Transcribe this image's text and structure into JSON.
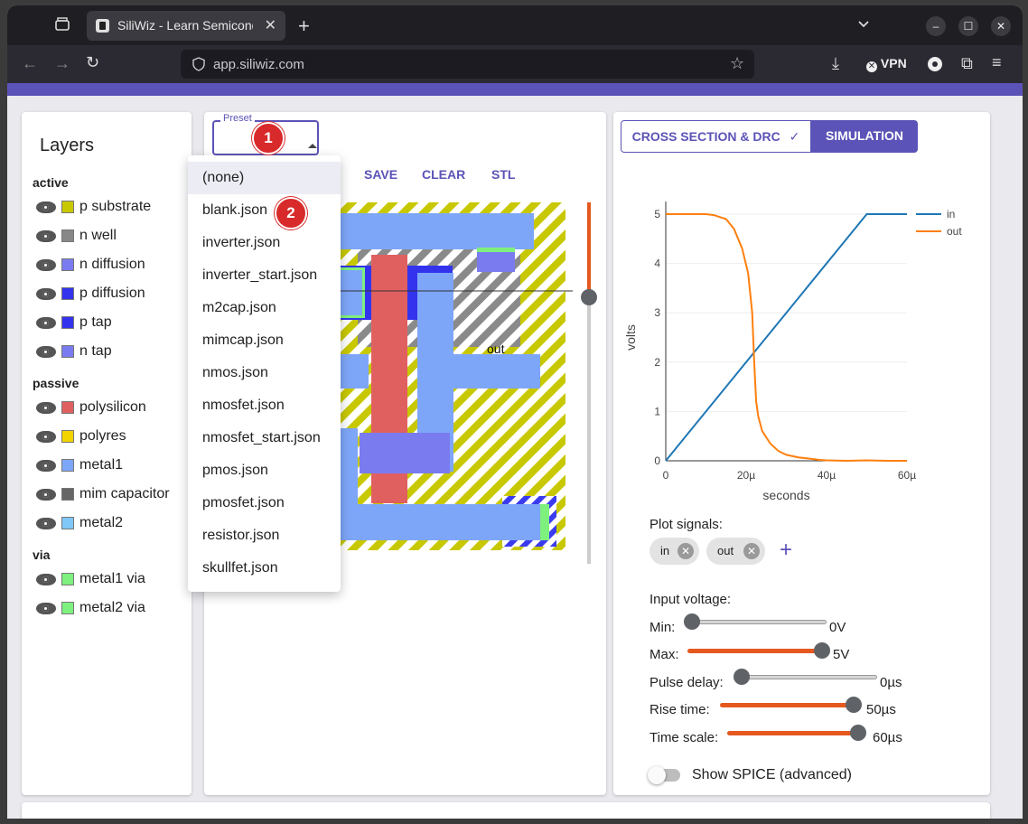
{
  "browser": {
    "tab_title": "SiliWiz - Learn Semiconductor",
    "url": "app.siliwiz.com",
    "vpn_label": "VPN"
  },
  "layers": {
    "title": "Layers",
    "groups": [
      {
        "label": "active",
        "items": [
          {
            "label": "p substrate",
            "color": "#c8c800"
          },
          {
            "label": "n well",
            "color": "#888888"
          },
          {
            "label": "n diffusion",
            "color": "#7b7bf0"
          },
          {
            "label": "p diffusion",
            "color": "#3333ee"
          },
          {
            "label": "p tap",
            "color": "#3333ee"
          },
          {
            "label": "n tap",
            "color": "#7b7bf0"
          }
        ]
      },
      {
        "label": "passive",
        "items": [
          {
            "label": "polysilicon",
            "color": "#e06060"
          },
          {
            "label": "polyres",
            "color": "#f2d400"
          },
          {
            "label": "metal1",
            "color": "#7ea6f8"
          },
          {
            "label": "mim capacitor",
            "color": "#666666"
          },
          {
            "label": "metal2",
            "color": "#7fc8f8"
          }
        ]
      },
      {
        "label": "via",
        "items": [
          {
            "label": "metal1 via",
            "color": "#7ef07e"
          },
          {
            "label": "metal2 via",
            "color": "#7ef07e"
          }
        ]
      }
    ]
  },
  "editor": {
    "preset_label": "Preset",
    "buttons": [
      "SAVE",
      "CLEAR",
      "STL"
    ],
    "canvas_label": "out",
    "preset_options": [
      "(none)",
      "blank.json",
      "inverter.json",
      "inverter_start.json",
      "m2cap.json",
      "mimcap.json",
      "nmos.json",
      "nmosfet.json",
      "nmosfet_start.json",
      "pmos.json",
      "pmosfet.json",
      "resistor.json",
      "skullfet.json"
    ]
  },
  "badges": [
    "1",
    "2"
  ],
  "simulation": {
    "tab_cross_section": "CROSS SECTION & DRC",
    "tab_simulation": "SIMULATION",
    "plot_signals_label": "Plot signals:",
    "signals": [
      "in",
      "out"
    ],
    "input_voltage_label": "Input voltage:",
    "sliders": [
      {
        "label": "Min:",
        "value": "0V",
        "fraction": 0.0
      },
      {
        "label": "Max:",
        "value": "5V",
        "fraction": 1.0
      },
      {
        "label": "Pulse delay:",
        "value": "0µs",
        "fraction": 0.0
      },
      {
        "label": "Rise time:",
        "value": "50µs",
        "fraction": 1.0
      },
      {
        "label": "Time scale:",
        "value": "60µs",
        "fraction": 1.0
      }
    ],
    "show_spice_label": "Show SPICE (advanced)"
  },
  "chart_data": {
    "type": "line",
    "xlabel": "seconds",
    "ylabel": "volts",
    "xlim": [
      0,
      60
    ],
    "ylim": [
      0,
      5
    ],
    "xticks": [
      "0",
      "20µ",
      "40µ",
      "60µ"
    ],
    "yticks": [
      "0",
      "1",
      "2",
      "3",
      "4",
      "5"
    ],
    "legend_position": "top-right",
    "series": [
      {
        "name": "in",
        "color": "#1f77b4",
        "x": [
          0,
          50,
          60
        ],
        "y": [
          0,
          5,
          5
        ]
      },
      {
        "name": "out",
        "color": "#ff7f0e",
        "x": [
          0,
          10,
          12,
          15,
          17,
          19,
          20.5,
          21.5,
          22,
          22.5,
          23,
          24,
          26,
          28,
          30,
          33,
          36,
          38,
          40,
          45,
          50,
          55,
          60
        ],
        "y": [
          5,
          5,
          4.98,
          4.9,
          4.7,
          4.3,
          3.8,
          3.0,
          2.0,
          1.2,
          0.9,
          0.6,
          0.35,
          0.2,
          0.12,
          0.07,
          0.04,
          0.02,
          0.01,
          0.0,
          0.01,
          0.0,
          0.0
        ]
      }
    ]
  }
}
